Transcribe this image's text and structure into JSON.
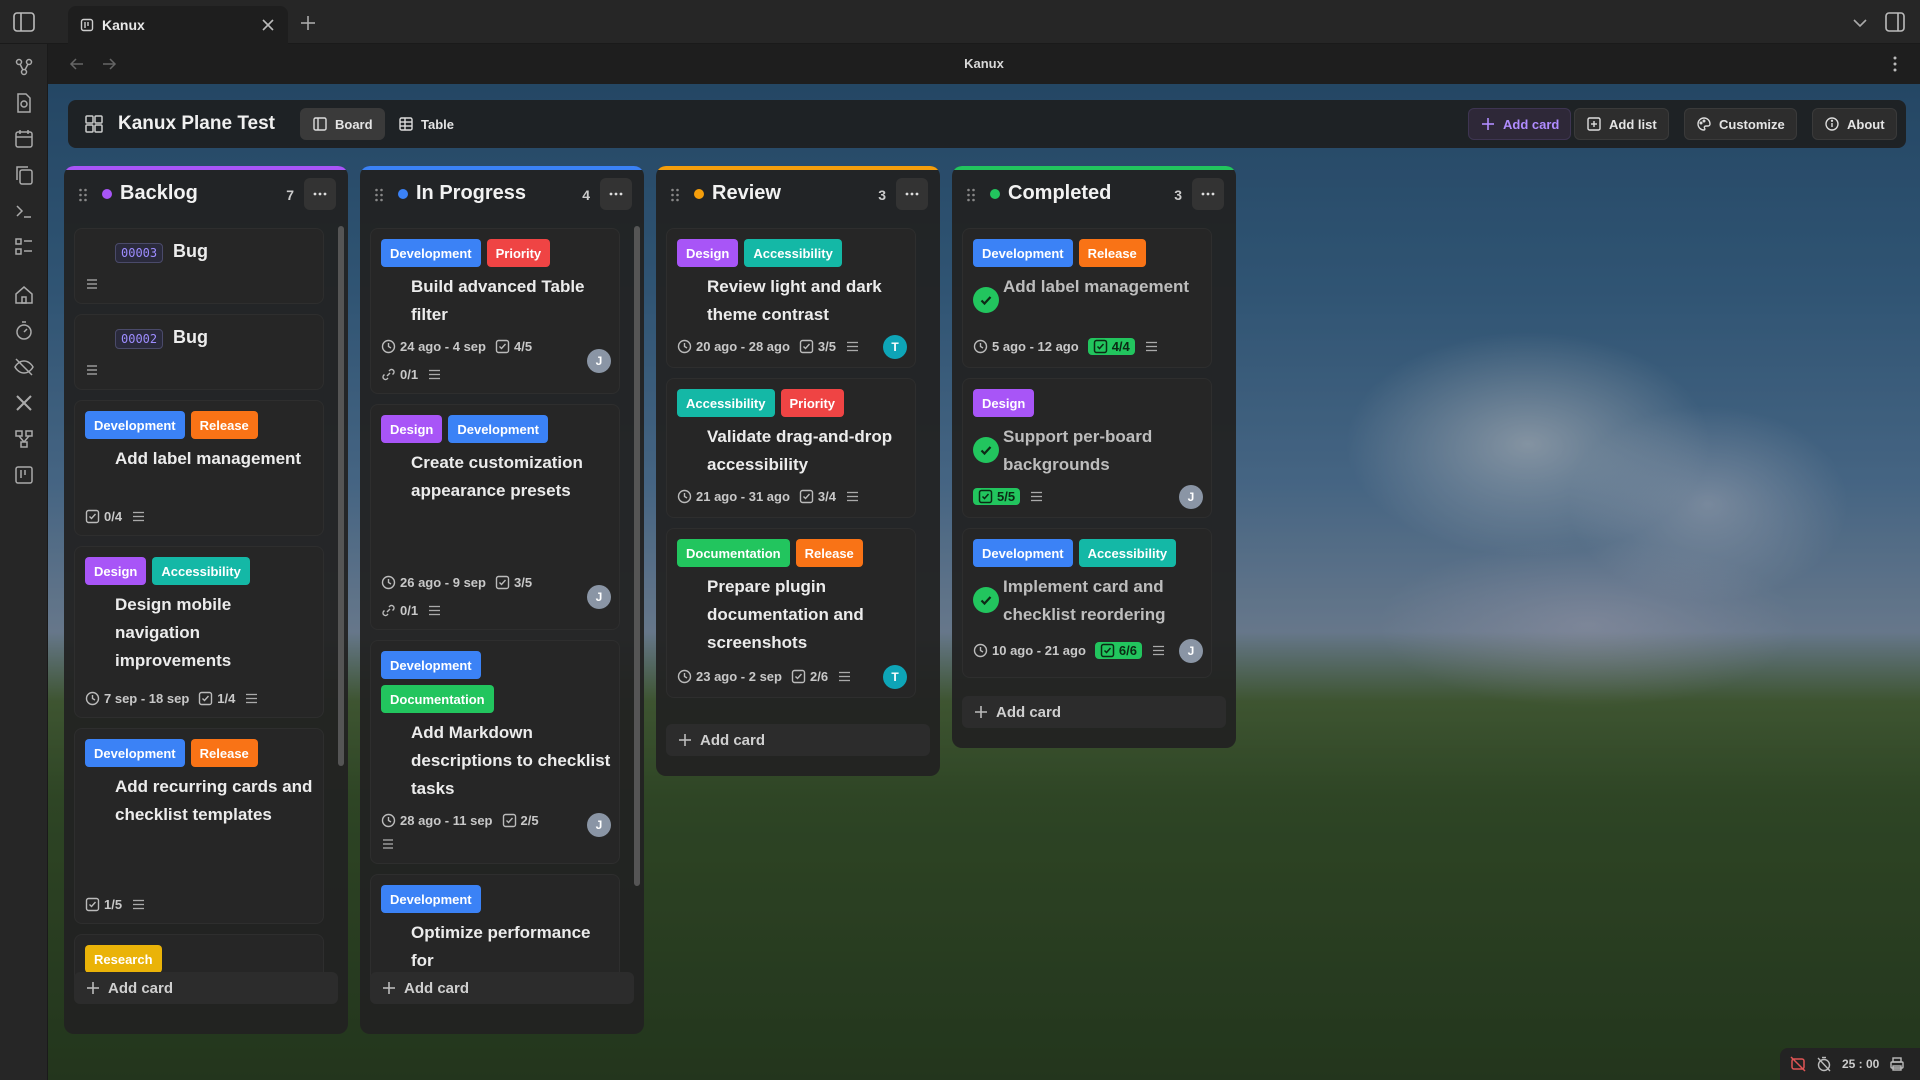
{
  "window": {
    "tab_title": "Kanux",
    "view_title": "Kanux"
  },
  "toolbar": {
    "board_title": "Kanux Plane Test",
    "board_label": "Board",
    "table_label": "Table",
    "add_card": "Add card",
    "add_list": "Add list",
    "customize": "Customize",
    "about": "About"
  },
  "colors": {
    "backlog": "#a855f7",
    "in_progress": "#3b82f6",
    "review": "#f59e0b",
    "completed": "#22c55e"
  },
  "lists": [
    {
      "name": "Backlog",
      "count": "7",
      "add_card": "Add card",
      "cards": [
        {
          "id": "00003",
          "title": "Bug"
        },
        {
          "id": "00002",
          "title": "Bug"
        },
        {
          "tags": [
            "Development",
            "Release"
          ],
          "title": "Add label management",
          "checklist": "0/4"
        },
        {
          "tags": [
            "Design",
            "Accessibility"
          ],
          "title": "Design mobile navigation improvements",
          "dates": "7 sep - 18 sep",
          "checklist": "1/4"
        },
        {
          "tags": [
            "Development",
            "Release"
          ],
          "title": "Add recurring cards and checklist templates",
          "checklist": "1/5"
        },
        {
          "tags": [
            "Research"
          ]
        }
      ]
    },
    {
      "name": "In Progress",
      "count": "4",
      "add_card": "Add card",
      "cards": [
        {
          "tags": [
            "Development",
            "Priority"
          ],
          "title": "Build advanced Table filter",
          "dates": "24 ago - 4 sep",
          "checklist": "4/5",
          "links": "0/1",
          "avatar": "J"
        },
        {
          "tags": [
            "Design",
            "Development"
          ],
          "title": "Create customization appearance presets",
          "dates": "26 ago - 9 sep",
          "checklist": "3/5",
          "links": "0/1",
          "avatar": "J"
        },
        {
          "tags": [
            "Development",
            "Documentation"
          ],
          "title": "Add Markdown descriptions to checklist tasks",
          "dates": "28 ago - 11 sep",
          "checklist": "2/5",
          "avatar": "J"
        },
        {
          "tags": [
            "Development"
          ],
          "title": "Optimize performance for"
        }
      ]
    },
    {
      "name": "Review",
      "count": "3",
      "add_card": "Add card",
      "cards": [
        {
          "tags": [
            "Design",
            "Accessibility"
          ],
          "title": "Review light and dark theme contrast",
          "dates": "20 ago - 28 ago",
          "checklist": "3/5",
          "avatar": "T"
        },
        {
          "tags": [
            "Accessibility",
            "Priority"
          ],
          "title": "Validate drag-and-drop accessibility",
          "dates": "21 ago - 31 ago",
          "checklist": "3/4"
        },
        {
          "tags": [
            "Documentation",
            "Release"
          ],
          "title": "Prepare plugin documentation and screenshots",
          "dates": "23 ago - 2 sep",
          "checklist": "2/6",
          "avatar": "T"
        }
      ]
    },
    {
      "name": "Completed",
      "count": "3",
      "add_card": "Add card",
      "cards": [
        {
          "tags": [
            "Development",
            "Release"
          ],
          "title": "Add label management",
          "dates": "5 ago - 12 ago",
          "checklist": "4/4"
        },
        {
          "tags": [
            "Design"
          ],
          "title": "Support per-board backgrounds",
          "checklist": "5/5",
          "avatar": "J"
        },
        {
          "tags": [
            "Development",
            "Accessibility"
          ],
          "title": "Implement card and checklist reordering",
          "dates": "10 ago - 21 ago",
          "checklist": "6/6",
          "avatar": "J"
        }
      ]
    }
  ],
  "status": {
    "timer": "25 : 00"
  }
}
